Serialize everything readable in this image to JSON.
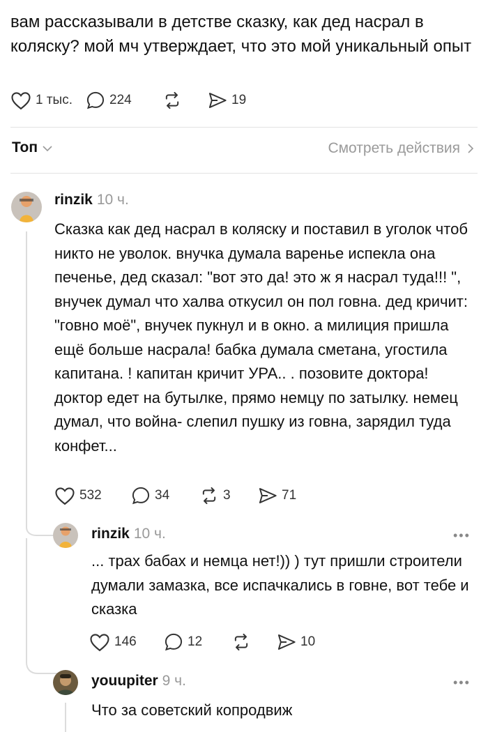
{
  "post": {
    "text": "вам рассказывали в детстве сказку, как дед насрал в коляску? мой мч утверждает, что это мой уникальный опыт",
    "likes": "1 тыс.",
    "replies": "224",
    "reposts": "",
    "shares": "19"
  },
  "sort": {
    "label": "Топ"
  },
  "view_activity": {
    "label": "Смотреть действия"
  },
  "comments": [
    {
      "username": "rinzik",
      "time": "10 ч.",
      "text": "Сказка как дед насрал в коляску и поставил в уголок чтоб никто не уволок. внучка думала варенье испекла она печенье, дед сказал: \"вот это да! это ж я насрал туда!!! \", внучек думал что халва откусил он пол говна. дед кричит: \"говно моё\", внучек пукнул и в окно. а милиция пришла ещё больше насрала! бабка думала сметана, угостила капитана. ! капитан кричит УРА.. . позовите доктора! доктор едет на бутылке, прямо немцу по затылку. немец думал, что война- слепил пушку из говна, зарядил туда конфет...",
      "likes": "532",
      "replies": "34",
      "reposts": "3",
      "shares": "71",
      "avatar_color": "#c9c2bb"
    },
    {
      "username": "rinzik",
      "time": "10 ч.",
      "text": "... трах бабах и немца нет!)) ) тут пришли строители думали замазка, все испачкались в говне, вот тебе и сказка",
      "more": "•••",
      "likes": "146",
      "replies": "12",
      "reposts": "",
      "shares": "10",
      "avatar_color": "#c9c2bb"
    },
    {
      "username": "youupiter",
      "time": "9 ч.",
      "text": "Что за советский копродвиж",
      "more": "•••",
      "avatar_color": "#6b5a3e"
    }
  ]
}
